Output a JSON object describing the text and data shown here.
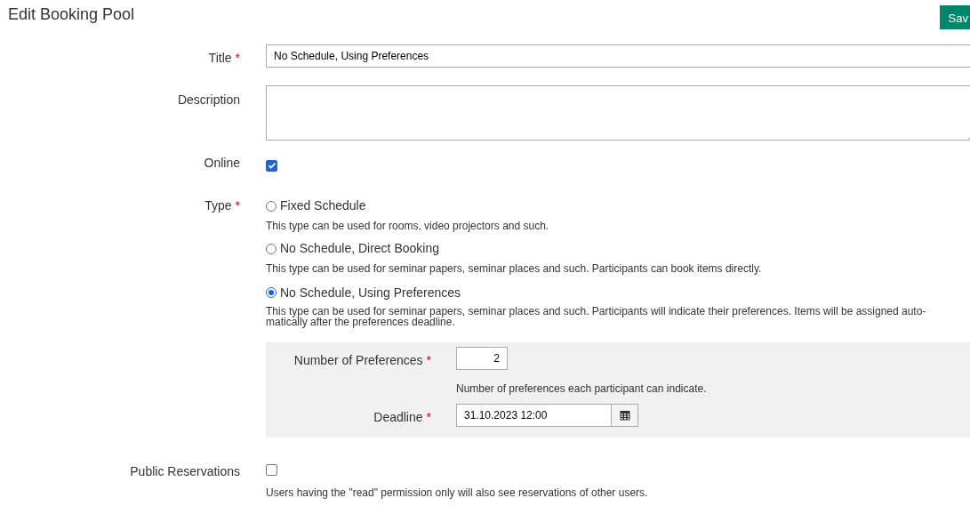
{
  "page_title": "Edit Booking Pool",
  "save_button": "Sav",
  "title_field": {
    "label": "Title",
    "required_marker": "*",
    "value": "No Schedule, Using Preferences"
  },
  "description_field": {
    "label": "Description"
  },
  "online": {
    "label": "Online",
    "checked": true
  },
  "type": {
    "label": "Type",
    "required_marker": "*",
    "options": [
      {
        "label": "Fixed Schedule",
        "selected": false,
        "help": "This type can be used for rooms, video projectors and such."
      },
      {
        "label": "No Schedule, Direct Booking",
        "selected": false,
        "help": "This type can be used for seminar papers, seminar places and such. Participants can book items directly."
      },
      {
        "label": "No Schedule, Using Preferences",
        "selected": true,
        "help": "This type can be used for seminar papers, seminar places and such. Participants will indicate their preferences. Items will be assigned auto-\nmatically after the preferences deadline."
      }
    ]
  },
  "preferences": {
    "number": {
      "label": "Number of Preferences",
      "required_marker": "*",
      "value": "2",
      "help": "Number of preferences each participant can indicate."
    },
    "deadline": {
      "label": "Deadline",
      "required_marker": "*",
      "value": "31.10.2023 12:00"
    }
  },
  "public_reservations": {
    "label": "Public Reservations",
    "checked": false,
    "help": "Users having the \"read\" permission only will also see reservations of other users."
  }
}
